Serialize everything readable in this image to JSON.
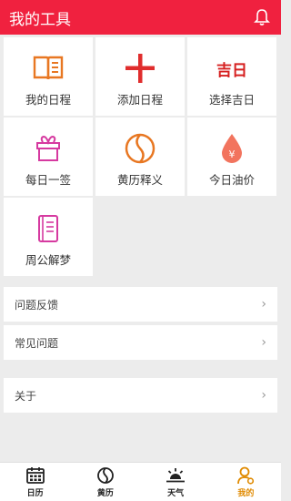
{
  "header": {
    "title": "我的工具",
    "icon": "bell-icon"
  },
  "tools": [
    {
      "label": "我的日程",
      "icon": "book-icon",
      "color": "#e87722"
    },
    {
      "label": "添加日程",
      "icon": "plus-icon",
      "color": "#e02d2d"
    },
    {
      "label": "选择吉日",
      "icon": "jiri-icon",
      "text": "吉日",
      "color": "#d62020"
    },
    {
      "label": "每日一签",
      "icon": "gift-icon",
      "color": "#d63aa0"
    },
    {
      "label": "黄历释义",
      "icon": "yinyang-icon",
      "color": "#e87722"
    },
    {
      "label": "今日油价",
      "icon": "oil-drop-icon",
      "text": "¥",
      "color": "#f2745e"
    },
    {
      "label": "周公解梦",
      "icon": "dream-book-icon",
      "color": "#d63aa0"
    }
  ],
  "list": [
    {
      "label": "问题反馈"
    },
    {
      "label": "常见问题"
    },
    {
      "label": "关于"
    }
  ],
  "chevron": "›",
  "tabs": [
    {
      "label": "日历",
      "icon": "calendar-icon"
    },
    {
      "label": "黄历",
      "icon": "yinyang-icon"
    },
    {
      "label": "天气",
      "icon": "sunrise-icon"
    },
    {
      "label": "我的",
      "icon": "person-icon",
      "active": true
    }
  ],
  "colors": {
    "brand": "#f0213f",
    "active_tab": "#e08a00"
  }
}
